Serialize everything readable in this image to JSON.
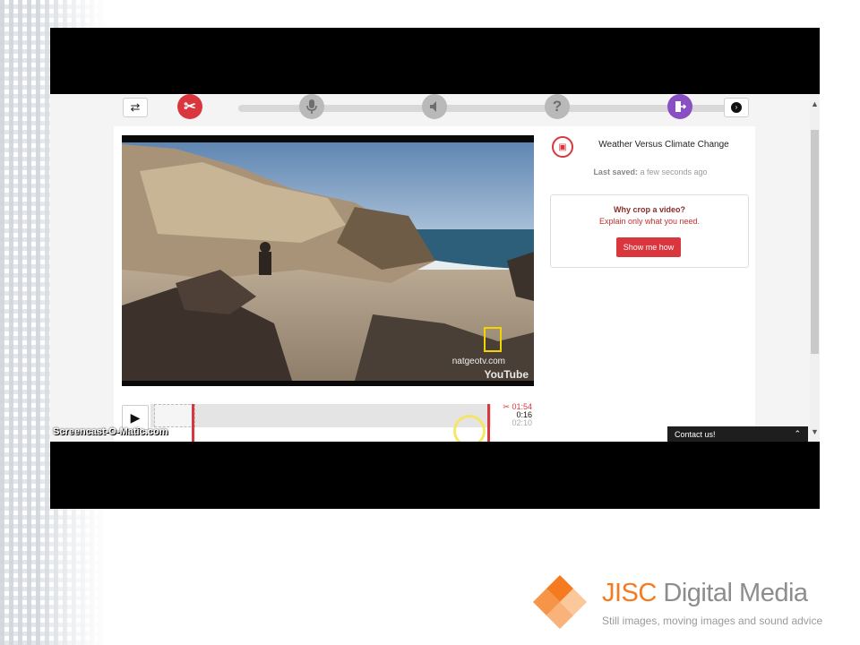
{
  "toolbar": {
    "swap_icon": "swap-icon",
    "next_icon": "chevron-right-icon",
    "steps": [
      {
        "name": "crop-step",
        "icon": "scissors",
        "state": "active"
      },
      {
        "name": "record-step",
        "icon": "microphone",
        "state": "idle"
      },
      {
        "name": "audio-step",
        "icon": "speaker",
        "state": "idle"
      },
      {
        "name": "quiz-step",
        "icon": "question",
        "state": "idle"
      },
      {
        "name": "finish-step",
        "icon": "exit",
        "state": "complete"
      }
    ]
  },
  "video": {
    "brand_text": "natgeotv.com",
    "platform_text": "YouTube"
  },
  "sidebar": {
    "title": "Weather Versus Climate Change",
    "saved_label": "Last saved:",
    "saved_value": "a few seconds ago",
    "tip": {
      "heading": "Why crop a video?",
      "subtext": "Explain only what you need.",
      "button": "Show me how"
    }
  },
  "timeline": {
    "end_time": "01:54",
    "current_time": "0:16",
    "duration": "02:10"
  },
  "contact": {
    "label": "Contact us!"
  },
  "watermark": "Screencast-O-Matic.com",
  "footer": {
    "brand_a": "JISC",
    "brand_b": "Digital Media",
    "tagline": "Still images, moving images and sound advice"
  },
  "colors": {
    "accent_red": "#d9363e",
    "accent_purple": "#8a4fc2",
    "brand_orange": "#f47b20"
  }
}
